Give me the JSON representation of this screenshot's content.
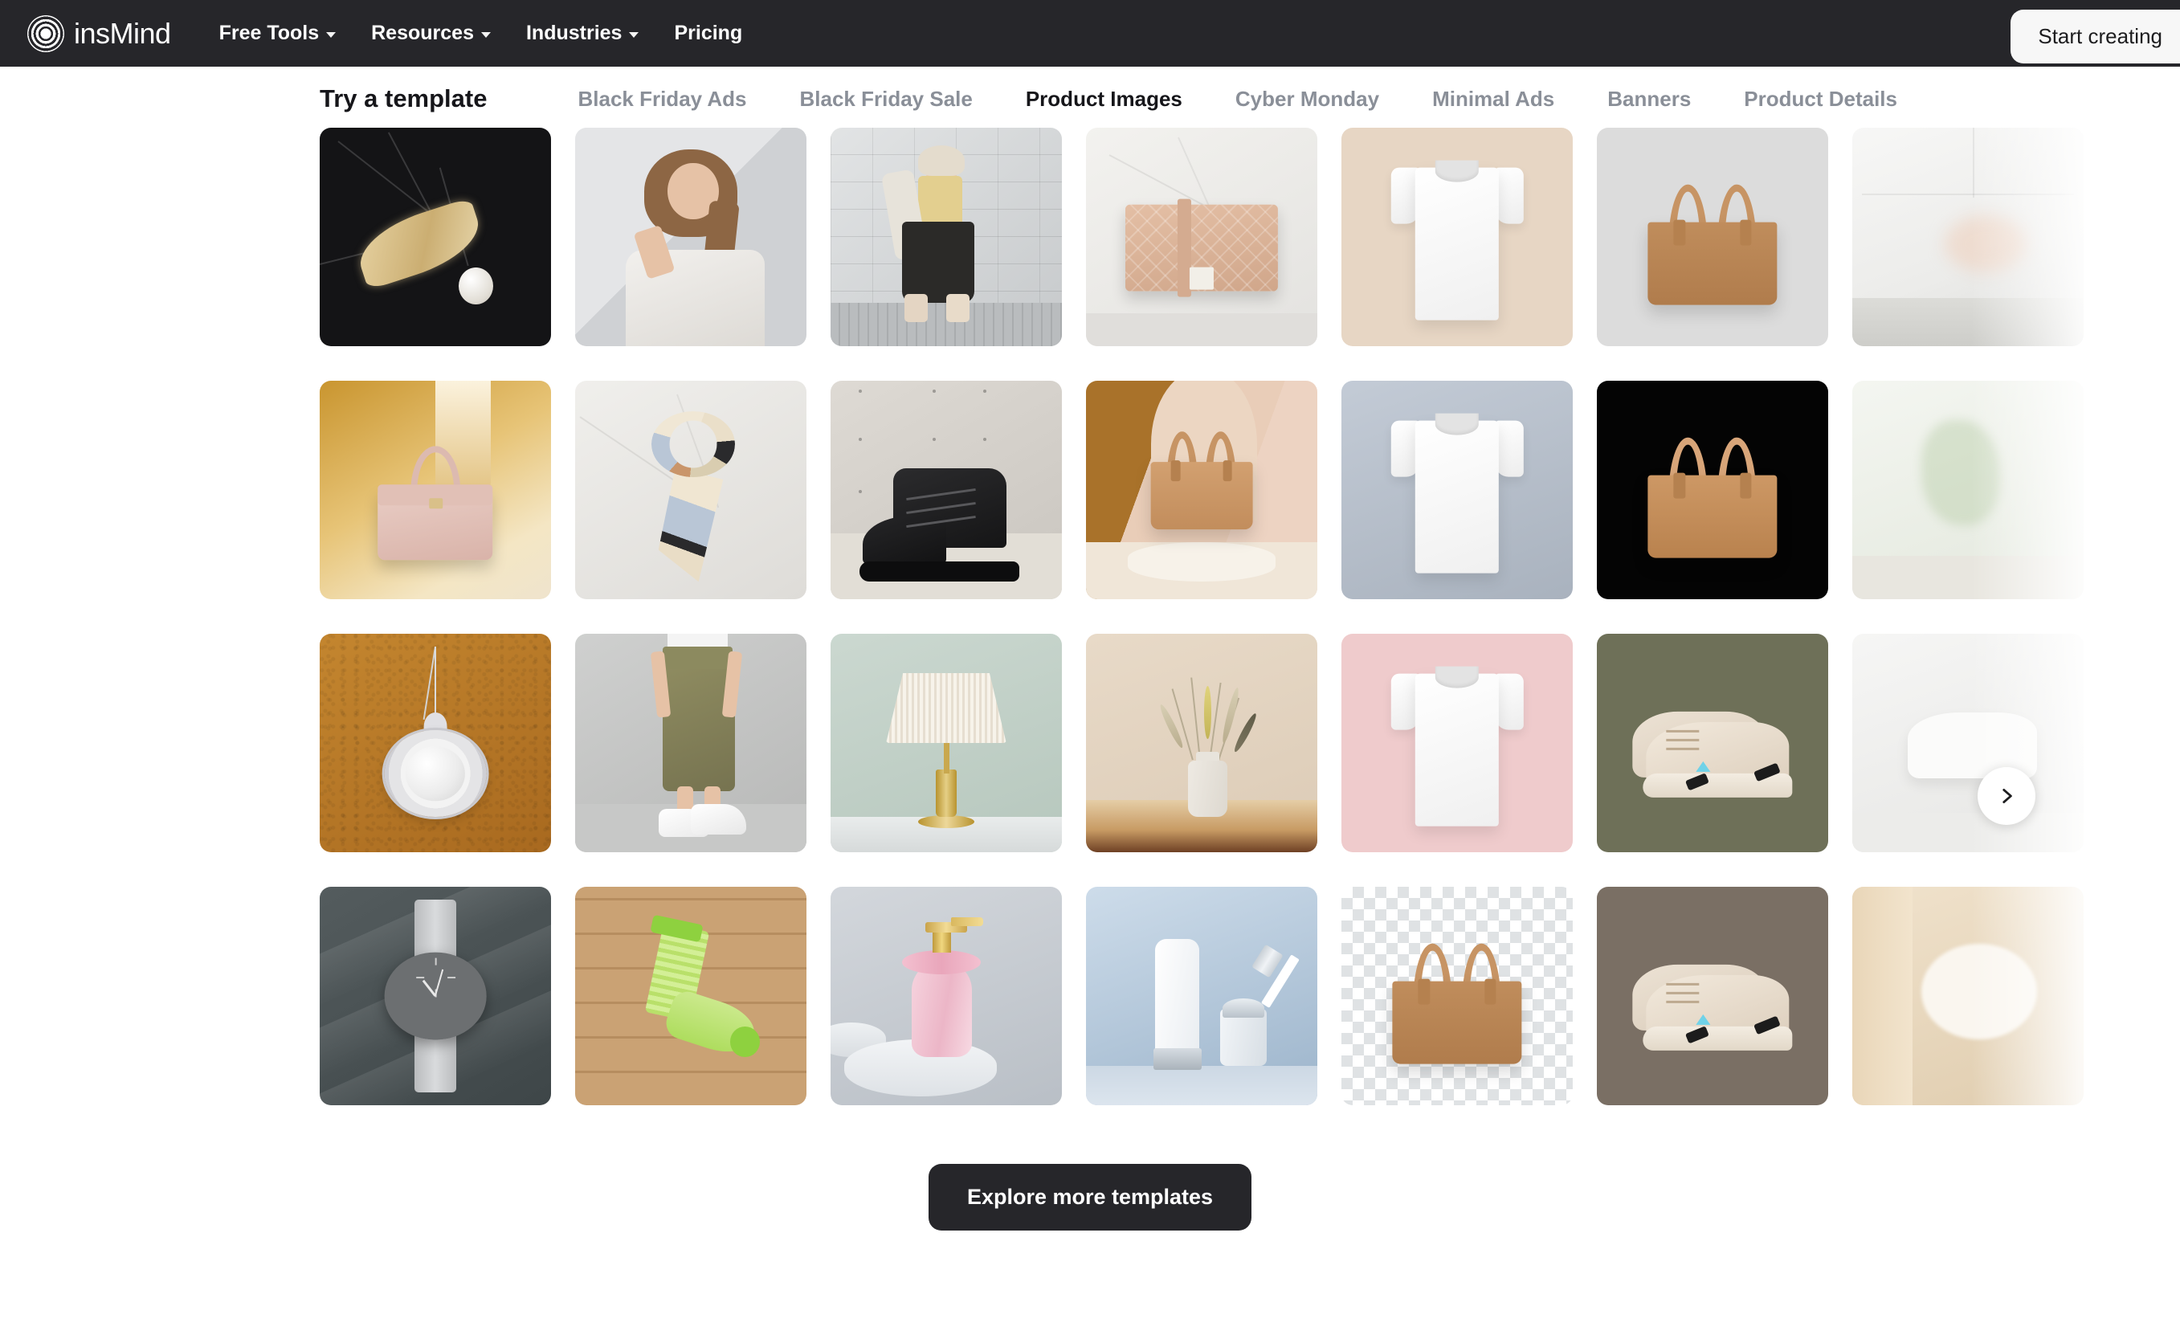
{
  "header": {
    "brand_name": "insMind",
    "logo_icon": "concentric-circles-logo",
    "nav_items": [
      {
        "label": "Free Tools",
        "has_dropdown": true
      },
      {
        "label": "Resources",
        "has_dropdown": true
      },
      {
        "label": "Industries",
        "has_dropdown": true
      },
      {
        "label": "Pricing",
        "has_dropdown": false
      }
    ],
    "cta_label": "Start creating",
    "background_color": "#26262a",
    "text_color": "#ffffff"
  },
  "section": {
    "title": "Try a template",
    "tabs": [
      {
        "label": "Black Friday Ads",
        "active": false
      },
      {
        "label": "Black Friday Sale",
        "active": false
      },
      {
        "label": "Product Images",
        "active": true
      },
      {
        "label": "Cyber Monday",
        "active": false
      },
      {
        "label": "Minimal Ads",
        "active": false
      },
      {
        "label": "Banners",
        "active": false
      },
      {
        "label": "Product Details",
        "active": false
      }
    ],
    "active_tab_color": "#16161a",
    "inactive_tab_color": "#8a8f98"
  },
  "carousel": {
    "next_button_icon": "chevron-right-icon",
    "columns": 7,
    "rows": 4,
    "cards": [
      {
        "id": "r1c1",
        "scene": "feather-brooch-black-marble",
        "alt": "Gold feather brooch with pearl on black marble",
        "bg": "#141416"
      },
      {
        "id": "r1c2",
        "scene": "model-woman-white-top",
        "alt": "Woman model in white top against light wall",
        "bg": "#d7d8da"
      },
      {
        "id": "r1c3",
        "scene": "model-woman-brick-wall",
        "alt": "Woman walking past grey brick wall",
        "bg": "#cdd0d2"
      },
      {
        "id": "r1c4",
        "scene": "quilted-flap-bag-marble",
        "alt": "Rose gold quilted flap bag on marble",
        "bg": "#ecebe8"
      },
      {
        "id": "r1c5",
        "scene": "tshirt-beige",
        "alt": "White t-shirt on beige background",
        "bg": "#e7d7c5"
      },
      {
        "id": "r1c6",
        "scene": "tote-bag-grey",
        "alt": "Tan leather tote bag on light grey",
        "bg": "#dcdcdc"
      },
      {
        "id": "r1c7",
        "scene": "blurred-white-cutoff",
        "alt": "Partially visible white scene",
        "bg": "#f2f1ef"
      },
      {
        "id": "r2c1",
        "scene": "pink-handbag-gold-satin",
        "alt": "Pink leather handbag on gold satin",
        "bg": "#c99a52"
      },
      {
        "id": "r2c2",
        "scene": "silk-scarf-marble",
        "alt": "Patterned silk scarf on marble",
        "bg": "#e8e7e4"
      },
      {
        "id": "r2c3",
        "scene": "black-boots-concrete",
        "alt": "Black lace-up boots against concrete wall",
        "bg": "#d9d5cf"
      },
      {
        "id": "r2c4",
        "scene": "tote-bag-podium-warm",
        "alt": "Tan tote bag on podium with warm backdrop",
        "bg": "#e7c9b4"
      },
      {
        "id": "r2c5",
        "scene": "tshirt-bluegrey",
        "alt": "White t-shirt on blue grey background",
        "bg": "#b9c1cc"
      },
      {
        "id": "r2c6",
        "scene": "tote-bag-black",
        "alt": "Tan tote bag on black background",
        "bg": "#050505"
      },
      {
        "id": "r2c7",
        "scene": "blurred-white-cutoff",
        "alt": "Partially visible pale scene",
        "bg": "#eef0ec"
      },
      {
        "id": "r3c1",
        "scene": "pearl-pendant-leather",
        "alt": "Pearl and crystal pendant necklace on tan leather",
        "bg": "#b5762f"
      },
      {
        "id": "r3c2",
        "scene": "model-joggers-sneakers",
        "alt": "Olive joggers and white sneakers against concrete",
        "bg": "#c5c6c6"
      },
      {
        "id": "r3c3",
        "scene": "table-lamp-sage",
        "alt": "Brass table lamp with pleated shade on sage wall",
        "bg": "#c2d0c8"
      },
      {
        "id": "r3c4",
        "scene": "vase-dried-flowers",
        "alt": "Ceramic vase with dried flowers on wooden table",
        "bg": "#e4d5c3"
      },
      {
        "id": "r3c5",
        "scene": "tshirt-pink",
        "alt": "White t-shirt on pink background",
        "bg": "#efc9ca"
      },
      {
        "id": "r3c6",
        "scene": "sneakers-olive",
        "alt": "Beige chunky sneakers on olive background",
        "bg": "#6e7058"
      },
      {
        "id": "r3c7",
        "scene": "blurred-white-cutoff",
        "alt": "Partially visible white shoe scene",
        "bg": "#f0efee"
      },
      {
        "id": "r4c1",
        "scene": "watch-grey-silk",
        "alt": "Grey strap wristwatch on dark silk",
        "bg": "#4a5255"
      },
      {
        "id": "r4c2",
        "scene": "green-sock-wood",
        "alt": "Green striped sock on wooden planks",
        "bg": "#c19268"
      },
      {
        "id": "r4c3",
        "scene": "pink-pump-bottle-podium",
        "alt": "Pink pump bottle on white podium",
        "bg": "#c9ccd2"
      },
      {
        "id": "r4c4",
        "scene": "cosmetics-blue",
        "alt": "Cosmetic tube and dropper bottle on blue backdrop",
        "bg": "#b5c7da"
      },
      {
        "id": "r4c5",
        "scene": "tote-bag-transparent",
        "alt": "Tan tote bag on transparency checkerboard",
        "bg": "#ffffff"
      },
      {
        "id": "r4c6",
        "scene": "sneakers-warmgrey",
        "alt": "Beige chunky sneakers on warm grey background",
        "bg": "#7a6f64"
      },
      {
        "id": "r4c7",
        "scene": "blurred-white-cutoff",
        "alt": "Partially visible pale wood scene",
        "bg": "#e8dccc"
      }
    ]
  },
  "footer": {
    "explore_label": "Explore more templates",
    "button_bg": "#26262a",
    "button_text_color": "#ffffff"
  }
}
